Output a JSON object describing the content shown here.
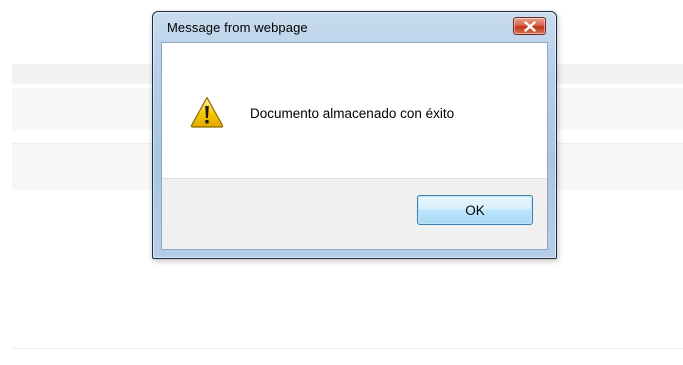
{
  "dialog": {
    "title": "Message from webpage",
    "message": "Documento almacenado con éxito",
    "ok_label": "OK",
    "close_icon": "close-icon",
    "message_icon": "warning-icon"
  },
  "colors": {
    "close_button": "#c2351a",
    "warning_yellow": "#f7c600",
    "ok_button": "#bee6fd"
  }
}
